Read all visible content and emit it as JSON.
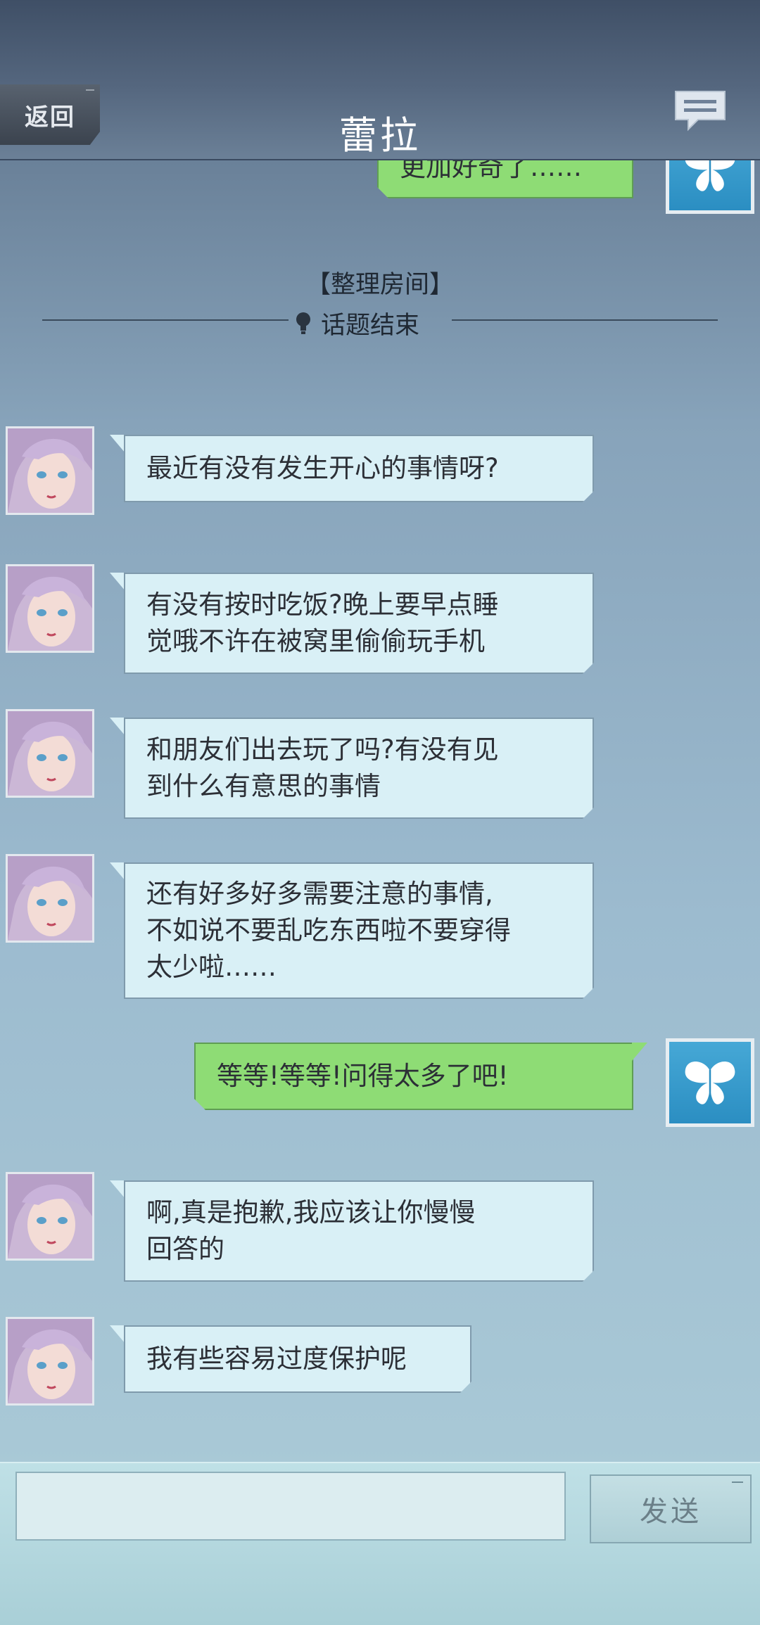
{
  "header": {
    "back_label": "返回",
    "title": "蕾拉",
    "chat_icon": "chat-bubbles-icon"
  },
  "messages": {
    "prev_sent": "更加好奇了……",
    "topic_name": "【整理房间】",
    "topic_end": "话题结束",
    "m1": "最近有没有发生开心的事情呀?",
    "m2_line1": "有没有按时吃饭?晚上要早点睡",
    "m2_line2": "觉哦不许在被窝里偷偷玩手机",
    "m3_line1": "和朋友们出去玩了吗?有没有见",
    "m3_line2": "到什么有意思的事情",
    "m4_line1": "还有好多好多需要注意的事情,",
    "m4_line2": "不如说不要乱吃东西啦不要穿得",
    "m4_line3": "太少啦……",
    "sent1": "等等!等等!问得太多了吧!",
    "m5_line1": "啊,真是抱歉,我应该让你慢慢",
    "m5_line2": "回答的",
    "m6": "我有些容易过度保护呢"
  },
  "input": {
    "value": "",
    "send_label": "发送"
  },
  "colors": {
    "received_bubble": "#d9f0f6",
    "sent_bubble": "#8edc75",
    "user_avatar": "#2b8ec2"
  }
}
